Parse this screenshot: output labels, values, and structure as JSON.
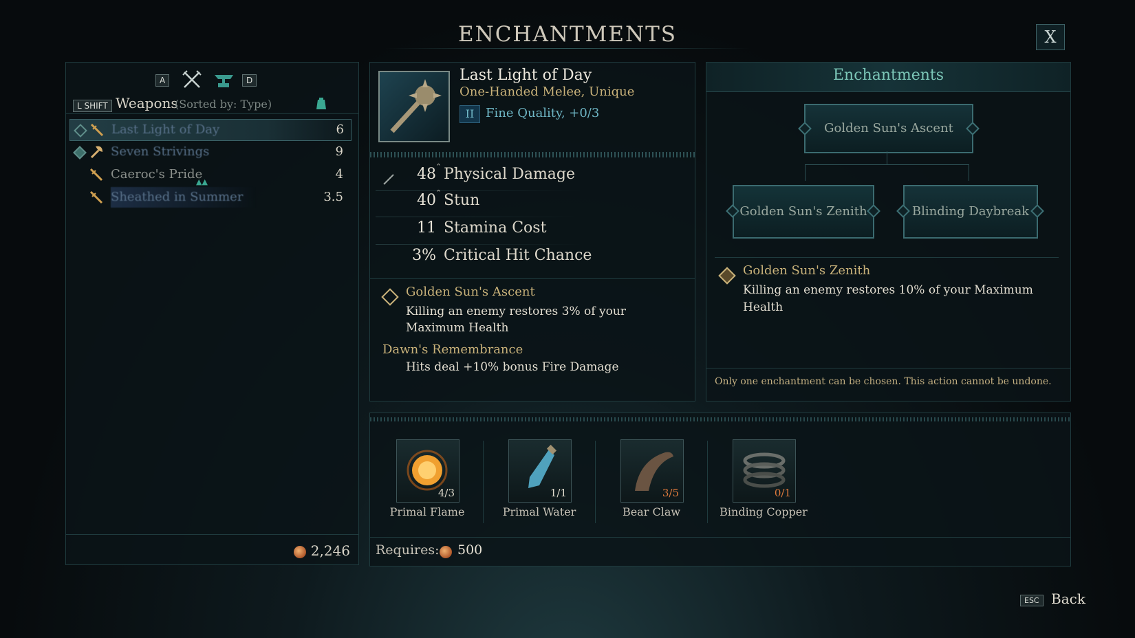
{
  "window": {
    "title": "ENCHANTMENTS",
    "close_label": "X"
  },
  "left": {
    "key_prev": "A",
    "key_next": "D",
    "sort_key": "L SHIFT",
    "category": "Weapons",
    "sort_text": "(Sorted by: Type)",
    "items": [
      {
        "name": "Last Light of Day",
        "value": "6"
      },
      {
        "name": "Seven Strivings",
        "value": "9"
      },
      {
        "name": "Caeroc's Pride",
        "value": "4"
      },
      {
        "name": "Sheathed in Summer",
        "value": "3.5"
      }
    ],
    "gold": "2,246"
  },
  "item": {
    "name": "Last Light of Day",
    "type": "One-Handed Melee, Unique",
    "quality_tier": "II",
    "quality": "Fine Quality, +0/3",
    "stats": [
      {
        "value": "48",
        "label": "Physical Damage"
      },
      {
        "value": "40",
        "label": "Stun"
      },
      {
        "value": "11",
        "label": "Stamina Cost"
      },
      {
        "value": "3%",
        "label": "Critical Hit Chance"
      }
    ],
    "enchant_name": "Golden Sun's Ascent",
    "enchant_desc": "Killing an enemy restores 3% of your Maximum Health",
    "passive_name": "Dawn's Remembrance",
    "passive_desc": "Hits deal +10% bonus Fire Damage"
  },
  "enchantments": {
    "title": "Enchantments",
    "root": "Golden Sun's Ascent",
    "left_choice": "Golden Sun's Zenith",
    "right_choice": "Blinding Daybreak",
    "selected_name": "Golden Sun's Zenith",
    "selected_desc": "Killing an enemy restores 10% of your Maximum Health",
    "note": "Only one enchantment can be chosen. This action cannot be undone."
  },
  "materials": [
    {
      "name": "Primal Flame",
      "count": "4/3"
    },
    {
      "name": "Primal Water",
      "count": "1/1"
    },
    {
      "name": "Bear Claw",
      "count": "3/5"
    },
    {
      "name": "Binding Copper",
      "count": "0/1"
    }
  ],
  "requires": {
    "label": "Requires:",
    "cost": "500"
  },
  "footer": {
    "esc_key": "ESC",
    "back_label": "Back"
  },
  "colors": {
    "accent_teal": "#6fb7c6",
    "gold_text": "#c9b27a",
    "insufficient": "#e07a3c"
  }
}
